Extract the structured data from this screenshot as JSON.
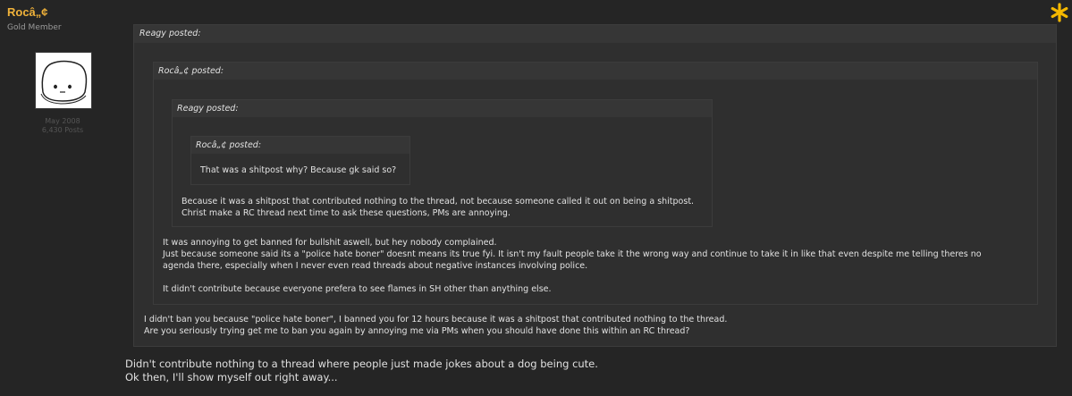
{
  "user": {
    "name": "Rocâ„¢",
    "title": "Gold Member",
    "join_date": "May 2008",
    "post_count": "6,430 Posts"
  },
  "quotes": {
    "level1": {
      "author": "Reagy posted:",
      "lines": [
        "I didn't ban you because \"police hate boner\", I banned you for 12 hours because it was a shitpost that contributed nothing to the thread.",
        "Are you seriously trying get me to ban you again by annoying me via PMs when you should have done this within an RC thread?"
      ]
    },
    "level2": {
      "author": "Rocâ„¢ posted:",
      "lines": [
        "It was annoying to get banned for bullshit aswell, but hey nobody complained.",
        "Just because someone said its a \"police hate boner\" doesnt means its true fyi. It isn't my fault people take it the wrong way and continue to take it in like that even despite me telling theres no",
        "agenda there, especially when I never even read threads about negative instances involving police.",
        "It didn't contribute because everyone prefera to see flames in SH other than anything else."
      ]
    },
    "level3": {
      "author": "Reagy posted:",
      "lines": [
        "Because it was a shitpost that contributed nothing to the thread, not because someone called it out on being a shitpost.",
        "Christ make a RC thread next time to ask these questions, PMs are annoying."
      ]
    },
    "level4": {
      "author": "Rocâ„¢ posted:",
      "lines": [
        "That was a shitpost why? Because gk said so?"
      ]
    }
  },
  "post": {
    "lines": [
      "Didn't contribute nothing to a thread where people just made jokes about a dog being cute.",
      "Ok then, I'll show myself out right away..."
    ]
  },
  "colors": {
    "background": "#252525",
    "username": "#f0b23a",
    "star": "#f5b800",
    "quote_bg": "#2f2f2f",
    "quote_header": "#363636"
  },
  "icons": {
    "star": "star-icon",
    "avatar": "blob-face-avatar"
  }
}
